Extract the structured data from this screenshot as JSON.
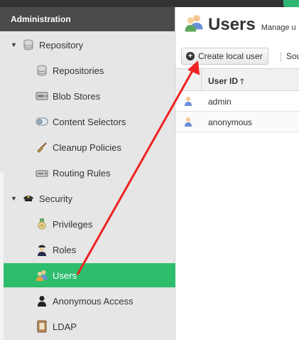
{
  "sidebar": {
    "header": "Administration",
    "items": [
      {
        "label": "Repository",
        "icon": "database-icon",
        "level": 0,
        "expanded": true
      },
      {
        "label": "Repositories",
        "icon": "database-icon",
        "level": 1
      },
      {
        "label": "Blob Stores",
        "icon": "server-drive-icon",
        "level": 1
      },
      {
        "label": "Content Selectors",
        "icon": "content-selector-icon",
        "level": 1
      },
      {
        "label": "Cleanup Policies",
        "icon": "broom-icon",
        "level": 1
      },
      {
        "label": "Routing Rules",
        "icon": "router-icon",
        "level": 1
      },
      {
        "label": "Security",
        "icon": "police-hat-icon",
        "level": 0,
        "expanded": true
      },
      {
        "label": "Privileges",
        "icon": "medal-icon",
        "level": 1
      },
      {
        "label": "Roles",
        "icon": "police-officer-icon",
        "level": 1
      },
      {
        "label": "Users",
        "icon": "users-icon",
        "level": 1,
        "selected": true
      },
      {
        "label": "Anonymous Access",
        "icon": "user-silhouette-icon",
        "level": 1
      },
      {
        "label": "LDAP",
        "icon": "address-book-icon",
        "level": 1
      }
    ]
  },
  "main": {
    "title": "Users",
    "subtitle": "Manage u",
    "toolbar": {
      "create_label": "Create local user",
      "source_label": "Sou"
    },
    "table": {
      "column_header": "User ID",
      "rows": [
        {
          "user_id": "admin"
        },
        {
          "user_id": "anonymous"
        }
      ]
    }
  },
  "colors": {
    "selected": "#2ebd6d",
    "header": "#4a4a4a",
    "annotation": "#ee2222"
  }
}
